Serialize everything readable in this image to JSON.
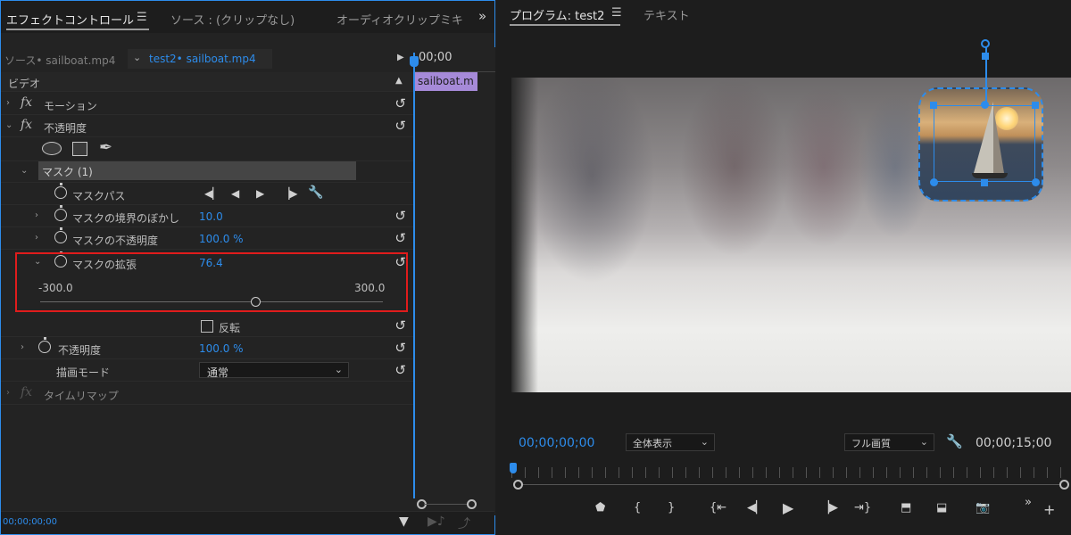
{
  "effect_panel": {
    "tabs": [
      {
        "label": "エフェクトコントロール"
      },
      {
        "label": "ソース : (クリップなし)"
      },
      {
        "label": "オーディオクリップミキ"
      }
    ],
    "source_clip": "ソース• sailboat.mp4",
    "target_clip": "test2• sailboat.mp4",
    "timeline_time": "00;00",
    "timeline_clip": "sailboat.m",
    "section_video": "ビデオ",
    "motion": "モーション",
    "opacity_group": "不透明度",
    "mask_header": "マスク (1)",
    "mask_path": "マスクパス",
    "mask_feather": {
      "label": "マスクの境界のぼかし",
      "value": "10.0"
    },
    "mask_opacity": {
      "label": "マスクの不透明度",
      "value": "100.0 %"
    },
    "mask_expansion": {
      "label": "マスクの拡張",
      "value": "76.4",
      "min": "-300.0",
      "max": "300.0",
      "fraction": 0.6273
    },
    "invert_label": "反転",
    "opacity": {
      "label": "不透明度",
      "value": "100.0 %"
    },
    "blend_mode": {
      "label": "描画モード",
      "value": "通常"
    },
    "time_remap": "タイムリマップ",
    "bottom_time": "00;00;00;00"
  },
  "program_panel": {
    "title": "プログラム: test2",
    "tab_text": "テキスト",
    "current_time": "00;00;00;00",
    "zoom": "全体表示",
    "quality": "フル画質",
    "duration": "00;00;15;00"
  },
  "colors": {
    "accent": "#2d8ceb",
    "highlight": "#e01c1c",
    "clip": "#a68ad8"
  }
}
